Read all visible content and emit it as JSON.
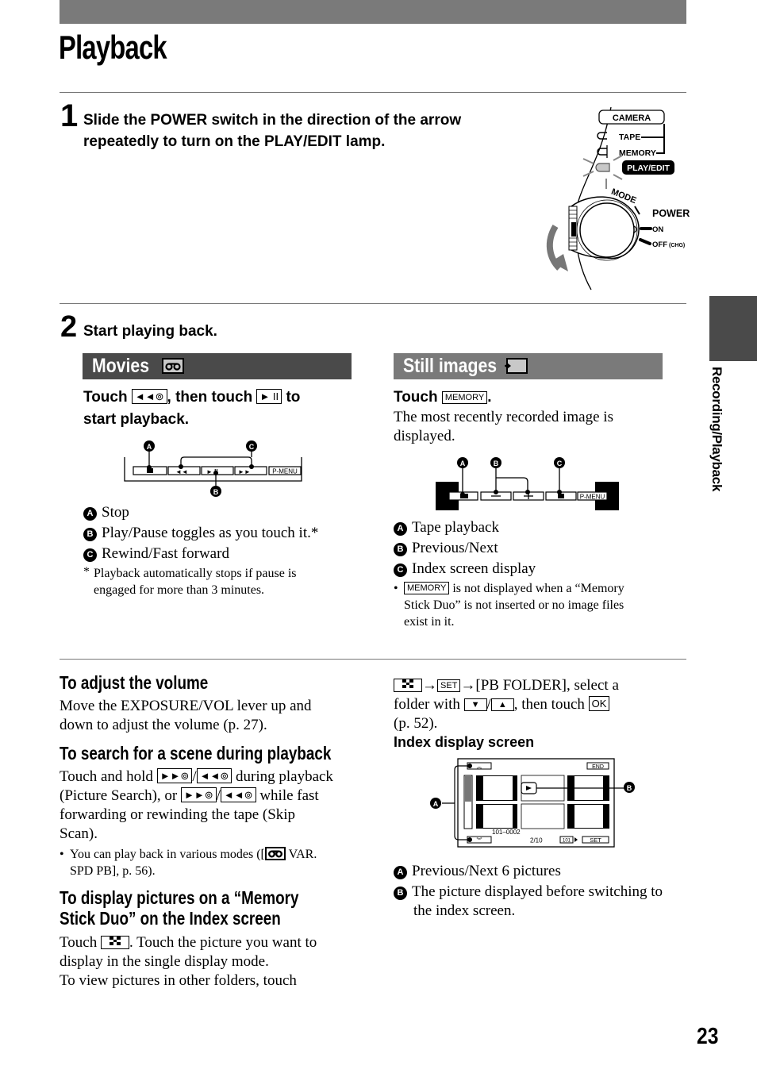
{
  "header": {
    "title": "Playback"
  },
  "side_tab": {
    "label": "Recording/Playback"
  },
  "page_number": "23",
  "step1": {
    "number": "1",
    "text_line1": "Slide the POWER switch in the direction of the arrow",
    "text_line2": "repeatedly to turn on the PLAY/EDIT lamp.",
    "illustration": {
      "mode_labels": [
        "CAMERA",
        "TAPE",
        "MEMORY",
        "PLAY/EDIT"
      ],
      "lit_lamp": "PLAY/EDIT",
      "mode_label": "MODE",
      "power_label": "POWER",
      "on_label": "ON",
      "off_label": "OFF",
      "off_suffix": "(CHG)"
    }
  },
  "step2": {
    "number": "2",
    "text": "Start playing back.",
    "movies": {
      "title": "Movies",
      "icon": "tape-icon",
      "instr_touch": "Touch",
      "instr_key1": "◄◄⊚",
      "instr_mid": ", then touch",
      "instr_key2": "► II",
      "instr_end": "to",
      "instr_line2": "start playback.",
      "panel": {
        "buttons": [
          "■",
          "◄◄",
          "► II",
          "►►",
          "P-MENU"
        ],
        "callouts": [
          "A",
          "B",
          "C"
        ]
      },
      "legend": [
        {
          "marker": "A",
          "text": "Stop"
        },
        {
          "marker": "B",
          "text": "Play/Pause toggles as you touch it.*"
        },
        {
          "marker": "C",
          "text": "Rewind/Fast forward"
        }
      ],
      "footnote_mark": "*",
      "footnote_line1": "Playback automatically stops if pause is",
      "footnote_line2": "engaged for more than 3 minutes."
    },
    "still": {
      "title": "Still images",
      "icon": "memory-card-icon",
      "instr_touch": "Touch",
      "instr_key": "MEMORY",
      "instr_end": ".",
      "desc_line1": "The most recently recorded image is",
      "desc_line2": "displayed.",
      "panel": {
        "buttons": [
          "tape",
          "−",
          "+",
          "index",
          "P-MENU"
        ],
        "callouts": [
          "A",
          "B",
          "C"
        ]
      },
      "legend": [
        {
          "marker": "A",
          "text": "Tape playback"
        },
        {
          "marker": "B",
          "text": "Previous/Next"
        },
        {
          "marker": "C",
          "text": "Index screen display"
        }
      ],
      "note_bullet": "•",
      "note_key": "MEMORY",
      "note_line1": "is not displayed when a “Memory",
      "note_line2": "Stick Duo” is not inserted or no image files",
      "note_line3": "exist in it."
    }
  },
  "volume": {
    "heading": "To adjust the volume",
    "line1": "Move the EXPOSURE/VOL lever up and",
    "line2": "down to adjust the volume (p. 27)."
  },
  "search": {
    "heading": "To search for a scene during playback",
    "l1_a": "Touch and hold",
    "l1_key1": "►►⊚",
    "slash": "/",
    "l1_key2": "◄◄⊚",
    "l1_b": "during playback",
    "l2_a": "(Picture Search), or",
    "l2_key1": "►►⊚",
    "l2_key2": "◄◄⊚",
    "l2_b": "while fast",
    "l3": "forwarding or rewinding the tape (Skip",
    "l4": "Scan).",
    "note_bullet": "•",
    "note_a": "You can play back in various modes ([",
    "note_b": "VAR.",
    "note_line2": "SPD PB], p. 56)."
  },
  "index_section": {
    "heading_line1": "To display pictures on a “Memory",
    "heading_line2": "Stick Duo” on the Index screen",
    "l1_a": "Touch",
    "l1_b": ". Touch the picture you want to",
    "l2": "display in the single display mode.",
    "l3": "To view pictures in other folders, touch",
    "r1_arrow": "→",
    "r1_key": "SET",
    "r1_b": "→[PB FOLDER], select a",
    "r2_a": "folder with",
    "r2_slash": "/",
    "r2_b": ", then touch",
    "r2_key": "OK",
    "r3": "(p. 52).",
    "screen_title": "Index display screen",
    "screen": {
      "end_label": "END",
      "file_name": "101–0002",
      "counter": "2/10",
      "folder": "101",
      "set_label": "SET",
      "callouts": [
        "A",
        "B"
      ]
    },
    "legend": [
      {
        "marker": "A",
        "text": "Previous/Next 6 pictures"
      },
      {
        "marker": "B",
        "text_line1": "The picture displayed before switching to",
        "text_line2": "the index screen."
      }
    ]
  }
}
